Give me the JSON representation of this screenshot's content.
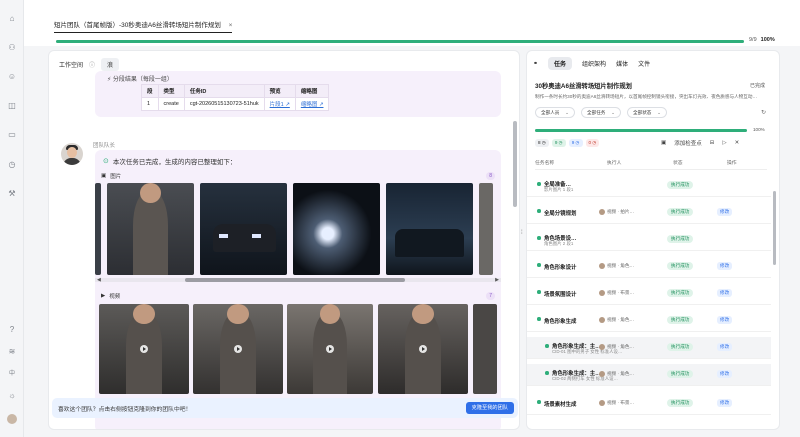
{
  "tab": {
    "title": "短片团队（首尾帧版）-30秒奥迪A6丝滑转场短片制作规划",
    "close": "×"
  },
  "top_progress": {
    "fraction": "9/9",
    "percent": "100%",
    "value": 1.0
  },
  "rail_icons": [
    "home-icon",
    "users-icon",
    "user-icon",
    "box-icon",
    "briefcase-icon",
    "clock-icon",
    "wrench-icon",
    "help-icon",
    "layers-icon",
    "language-icon",
    "sun-icon",
    "profile-avatar"
  ],
  "rail_lang": "中",
  "workspace": {
    "label": "工作空间",
    "info": "ⓘ",
    "chip": "浪"
  },
  "shot_table": {
    "heading": "⚡ 分段结果（每段一组）",
    "headers": [
      "段",
      "类型",
      "任务ID",
      "预览",
      "缩略图"
    ],
    "row": [
      "1",
      "create",
      "cgt-20260515130723-51huk",
      "片段1 ↗",
      "缩略图 ↗"
    ]
  },
  "message": {
    "role": "团队队长",
    "done": "本次任务已完成，生成的内容已整理如下：",
    "images_label": "图片",
    "images_count": "8",
    "videos_label": "视频",
    "videos_count": "7"
  },
  "bottom_bar": {
    "text": "喜欢这个团队？点击右侧按钮克隆到你的团队中吧！",
    "button": "克隆至我的团队"
  },
  "splitter": "⁞",
  "right_panel": {
    "tabs": [
      "任务",
      "组织架构",
      "媒体",
      "文件"
    ],
    "title": "30秒奥迪A6丝滑转场短片制作规划",
    "title_action": "已完成",
    "desc": "制作一条时长约30秒的奥迪A6丝滑转场短片，以首尾帧控制镜头衔接，突出车灯光效、夜色质感与人物互动…",
    "filters": [
      "全部人员",
      "全部任务",
      "全部状态"
    ],
    "progress": {
      "percent": "100%",
      "value": 1.0
    },
    "badges": [
      "8 ◷",
      "9 ◷",
      "9 ◷",
      "0 ◷"
    ],
    "tools": [
      "▣",
      "添加检查点",
      "⊟",
      "▷",
      "✕"
    ],
    "columns": [
      "任务名称",
      "执行人",
      "状态",
      "操作"
    ],
    "rows": [
      {
        "name": "全局准备…",
        "sub": "影片图片 1 段1",
        "executor": "",
        "status": "执行成功",
        "op": ""
      },
      {
        "name": "全局分镜规划",
        "sub": "",
        "executor": "视频 · 拍片…",
        "status": "执行成功",
        "op": "修改"
      },
      {
        "name": "角色场景设…",
        "sub": "角色图片 2 段1",
        "executor": "",
        "status": "执行成功",
        "op": ""
      },
      {
        "name": "角色形象设计",
        "sub": "",
        "executor": "视频 · 角色…",
        "status": "执行成功",
        "op": "修改"
      },
      {
        "name": "场景氛围设计",
        "sub": "",
        "executor": "视频 · 布景…",
        "status": "执行成功",
        "op": "修改"
      },
      {
        "name": "角色形象生成",
        "sub": "",
        "executor": "视频 · 角色…",
        "status": "执行成功",
        "op": "修改"
      },
      {
        "name": "角色形象生成：主…",
        "sub": "CID-01 图中的男子 女性 标准人设…",
        "executor": "视频 · 角色…",
        "status": "执行成功",
        "op": "修改"
      },
      {
        "name": "角色形象生成：主…",
        "sub": "CID-02 两侧打车 女性 标准人设…",
        "executor": "视频 · 角色…",
        "status": "执行成功",
        "op": "修改"
      },
      {
        "name": "场景素材生成",
        "sub": "",
        "executor": "视频 · 布景…",
        "status": "执行成功",
        "op": "修改"
      }
    ]
  },
  "colors": {
    "accent": "#2eae7a",
    "brand": "#2f6fe8",
    "card": "#f6f0fb"
  }
}
